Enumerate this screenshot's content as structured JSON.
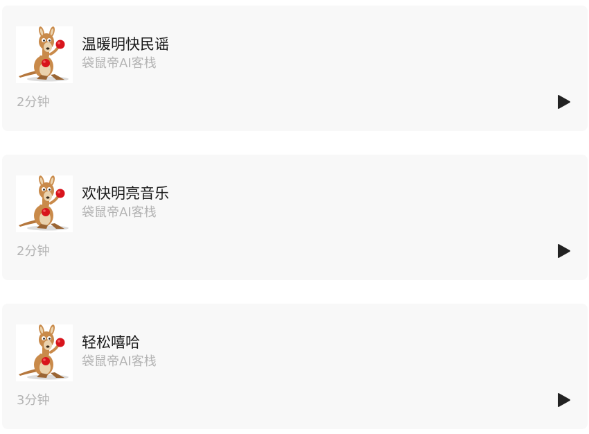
{
  "tracks": [
    {
      "title": "温暖明快民谣",
      "author": "袋鼠帝AI客栈",
      "duration": "2分钟",
      "thumbnail_icon": "kangaroo-boxer-image",
      "play_icon": "play-icon"
    },
    {
      "title": "欢快明亮音乐",
      "author": "袋鼠帝AI客栈",
      "duration": "2分钟",
      "thumbnail_icon": "kangaroo-boxer-image",
      "play_icon": "play-icon"
    },
    {
      "title": "轻松嘻哈",
      "author": "袋鼠帝AI客栈",
      "duration": "3分钟",
      "thumbnail_icon": "kangaroo-boxer-image",
      "play_icon": "play-icon"
    }
  ],
  "colors": {
    "card_background": "#f8f8f8",
    "title_text": "#1a1a1a",
    "secondary_text": "#b3b3b3",
    "play_icon": "#222222",
    "boxing_glove": "#d8141c",
    "kangaroo_fur": "#c98a4a"
  }
}
